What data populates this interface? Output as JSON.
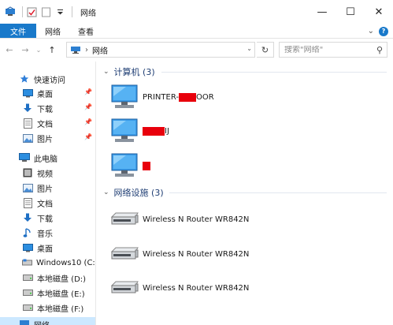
{
  "window": {
    "title": "网络",
    "controls": {
      "minimize": "—",
      "maximize": "☐",
      "close": "✕"
    }
  },
  "ribbon": {
    "tabs": [
      "文件",
      "网络",
      "查看"
    ],
    "expand_glyph": "⌄",
    "help_glyph": "?"
  },
  "navigation": {
    "back": "←",
    "forward": "→",
    "recent": "⌄",
    "up": "↑",
    "address_path": "网络",
    "address_chevron": "›",
    "dropdown": "⌄",
    "refresh": "↻",
    "search_placeholder": "搜索\"网络\"",
    "search_icon": "⚲"
  },
  "sidebar": {
    "items": [
      {
        "label": "快速访问",
        "icon": "star-icon"
      },
      {
        "label": "桌面",
        "icon": "desktop-icon",
        "pinned": true
      },
      {
        "label": "下载",
        "icon": "download-icon",
        "pinned": true
      },
      {
        "label": "文档",
        "icon": "documents-icon",
        "pinned": true
      },
      {
        "label": "图片",
        "icon": "pictures-icon",
        "pinned": true
      },
      {
        "label": "此电脑",
        "icon": "computer-icon"
      },
      {
        "label": "视频",
        "icon": "videos-icon"
      },
      {
        "label": "图片",
        "icon": "pictures-icon"
      },
      {
        "label": "文档",
        "icon": "documents-icon"
      },
      {
        "label": "下载",
        "icon": "download-icon"
      },
      {
        "label": "音乐",
        "icon": "music-icon"
      },
      {
        "label": "桌面",
        "icon": "desktop-icon"
      },
      {
        "label": "Windows10 (C:)",
        "icon": "system-drive-icon"
      },
      {
        "label": "本地磁盘 (D:)",
        "icon": "drive-icon"
      },
      {
        "label": "本地磁盘 (E:)",
        "icon": "drive-icon"
      },
      {
        "label": "本地磁盘 (F:)",
        "icon": "drive-icon"
      },
      {
        "label": "网络",
        "icon": "network-icon"
      }
    ]
  },
  "groups": [
    {
      "title": "计算机 (3)",
      "items": [
        {
          "label_prefix": "PRINTER-",
          "label_suffix": "OOR",
          "redacted": true
        },
        {
          "label_prefix": "",
          "label_suffix": "IJ",
          "redacted": true
        },
        {
          "label_prefix": "",
          "label_suffix": "",
          "redacted": true
        }
      ]
    },
    {
      "title": "网络设施 (3)",
      "items": [
        {
          "label": "Wireless N Router WR842N"
        },
        {
          "label": "Wireless N Router WR842N"
        },
        {
          "label": "Wireless N Router WR842N"
        }
      ]
    }
  ],
  "colors": {
    "accent": "#1979ca",
    "group_title": "#1e3d73",
    "redaction": "#e8000c",
    "selection": "#cce8ff"
  }
}
